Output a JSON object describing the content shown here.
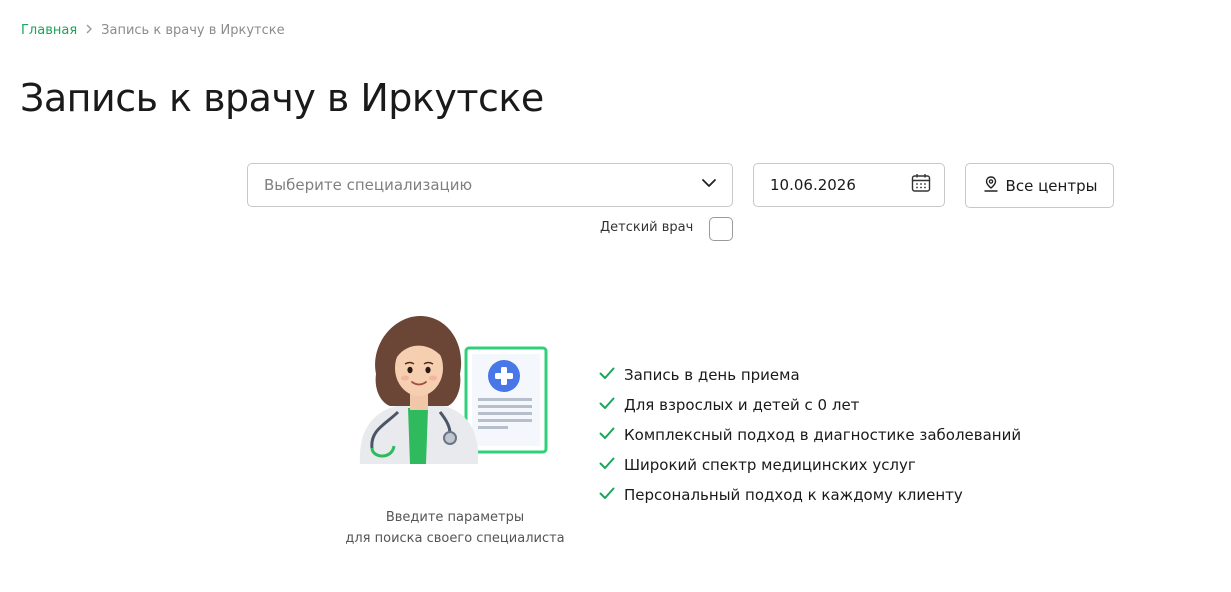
{
  "breadcrumb": {
    "home": "Главная",
    "current": "Запись к врачу в Иркутске"
  },
  "page_title": "Запись к врачу в Иркутске",
  "filters": {
    "specialization_placeholder": "Выберите специализацию",
    "date_value": "10.06.2026",
    "centers_label": "Все центры",
    "kids_doctor_label": "Детский врач",
    "kids_doctor_checked": false
  },
  "features": [
    "Запись в день приема",
    "Для взрослых и детей с 0 лет",
    "Комплексный подход в диагностике заболеваний",
    "Широкий спектр медицинских услуг",
    "Персональный подход к каждому клиенту"
  ],
  "hint": {
    "line1": "Введите параметры",
    "line2": "для поиска своего специалиста"
  },
  "colors": {
    "accent": "#1aa55a",
    "border": "#c8c8c8",
    "text": "#1a1a1a",
    "muted": "#808080"
  },
  "icons": {
    "breadcrumb_separator": "chevron-right-icon",
    "select": "chevron-down-icon",
    "date": "calendar-icon",
    "centers": "location-pin-icon",
    "feature": "check-icon"
  }
}
